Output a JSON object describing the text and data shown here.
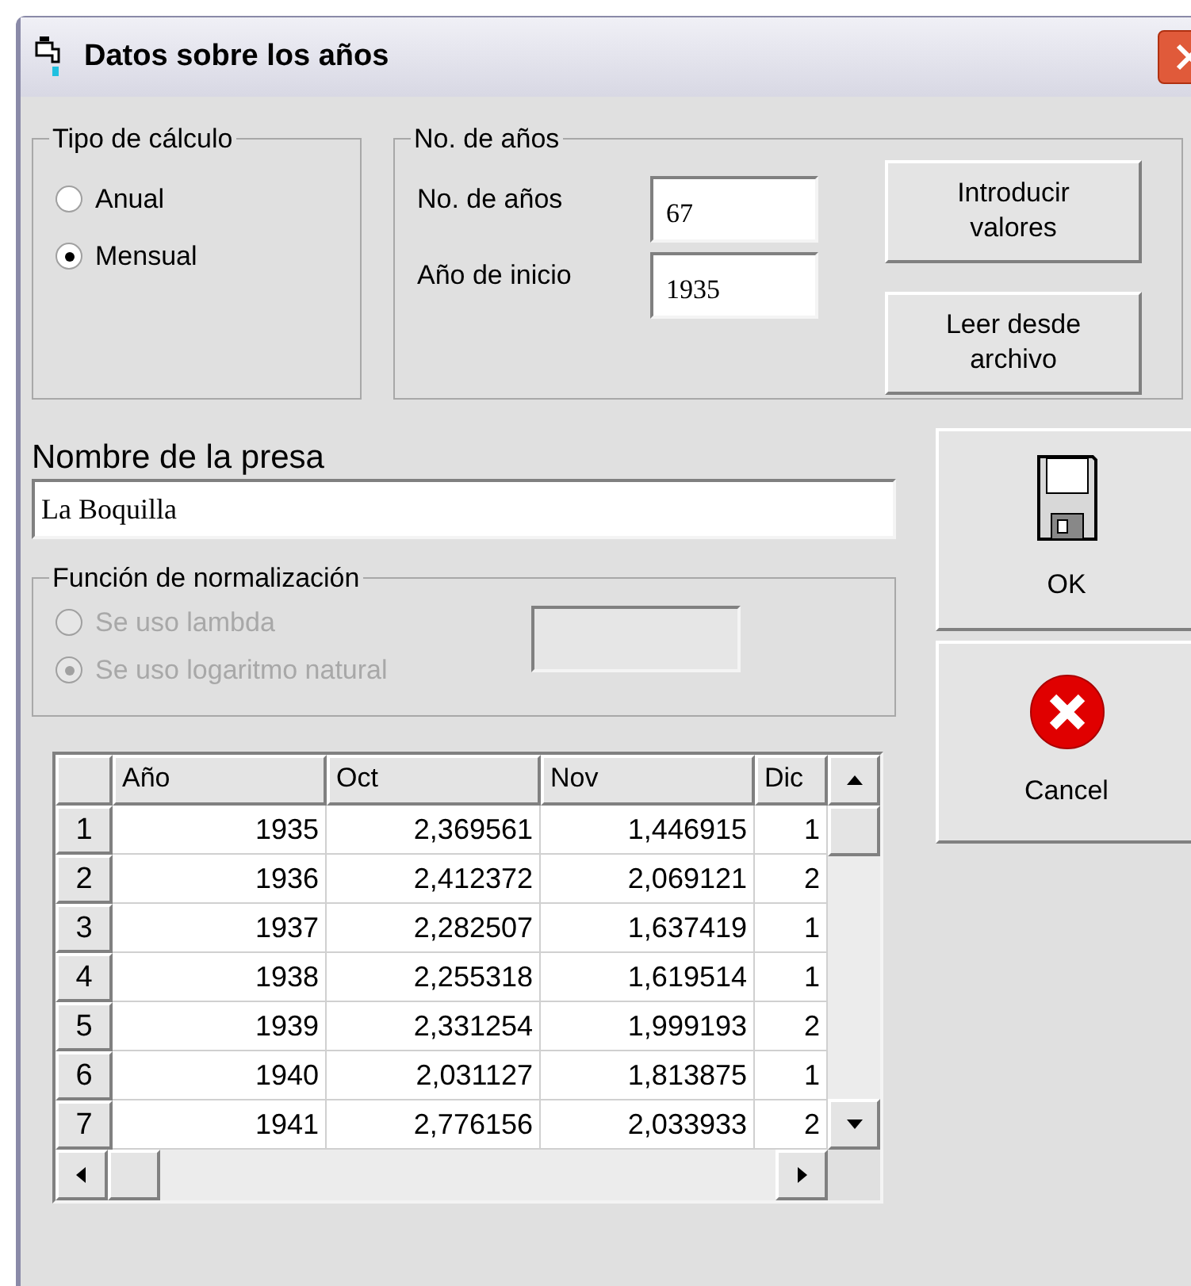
{
  "window": {
    "title": "Datos sobre los años"
  },
  "calc_type": {
    "label": "Tipo de cálculo",
    "options": [
      {
        "label": "Anual",
        "selected": false
      },
      {
        "label": "Mensual",
        "selected": true
      }
    ]
  },
  "years": {
    "label": "No. de años",
    "fields": [
      {
        "label": "No. de años",
        "value": "67"
      },
      {
        "label": "Año de inicio",
        "value": "1935"
      }
    ],
    "buttons": [
      "Introducir valores",
      "Leer desde archivo"
    ]
  },
  "dam_name": {
    "label": "Nombre de la presa",
    "value": "La Boquilla"
  },
  "normalization": {
    "label": "Función de normalización",
    "disabled": true,
    "options": [
      {
        "label": "Se uso lambda",
        "selected": false
      },
      {
        "label": "Se uso logaritmo natural",
        "selected": true
      }
    ]
  },
  "table": {
    "columns": [
      "Año",
      "Oct",
      "Nov",
      "Dic"
    ],
    "rows": [
      {
        "number": "1",
        "cells": [
          "1935",
          "2,369561",
          "1,446915",
          "1"
        ]
      },
      {
        "number": "2",
        "cells": [
          "1936",
          "2,412372",
          "2,069121",
          "2"
        ]
      },
      {
        "number": "3",
        "cells": [
          "1937",
          "2,282507",
          "1,637419",
          "1"
        ]
      },
      {
        "number": "4",
        "cells": [
          "1938",
          "2,255318",
          "1,619514",
          "1"
        ]
      },
      {
        "number": "5",
        "cells": [
          "1939",
          "2,331254",
          "1,999193",
          "2"
        ]
      },
      {
        "number": "6",
        "cells": [
          "1940",
          "2,031127",
          "1,813875",
          "1"
        ]
      },
      {
        "number": "7",
        "cells": [
          "1941",
          "2,776156",
          "2,033933",
          "2"
        ]
      }
    ]
  },
  "ok_button": {
    "label": "OK"
  },
  "cancel_button": {
    "label": "Cancel"
  }
}
